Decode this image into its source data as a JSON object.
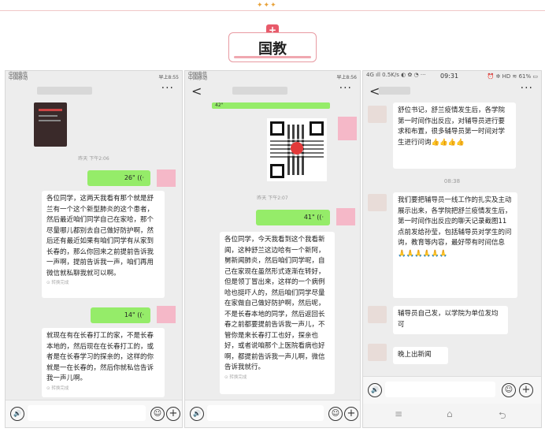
{
  "header": {
    "badge_label": "国教",
    "plus_symbol": "+",
    "dots": "✦✦✦"
  },
  "phone1": {
    "status_carrier": "中国电信\n中国移动",
    "status_time": "早上8:55",
    "more": "···",
    "timestamp": "昨天 下午2:06",
    "voice1": "26\" ((·",
    "voice2": "14\" ((·",
    "msg1": "各位同学，这两天我看有那个就是舒兰有一个这个新型肺炎的这个患者，然后最近咱们同学自己在家哈，那个尽量哪儿都别去自己做好防护啊，然后还有最近如果有咱们同学有从家到长春的，那么你回来之前提前告诉我一声啊，提前告诉我一声，咱们再用微信就私聊我就可以啊。",
    "msg1_note": "⊙ 转换完成",
    "msg2": "就现在有在长春打工的家，不是长春本地的，然后现在在长春打工的，或者是在长春学习的探亲的，这样的你就是一在长春的，然后你就私信告诉我一声儿啊。",
    "msg2_note": "⊙ 转换完成",
    "voice_icon": "🔊",
    "emoji": "☺",
    "plus": "+"
  },
  "phone2": {
    "status_carrier": "中国电信\n中国移动",
    "status_time": "早上8:56",
    "back": "<",
    "more": "···",
    "top_voice": "42\"",
    "timestamp": "昨天 下午2:07",
    "voice": "41\" ((·",
    "msg": "各位同学，今天我看到这个我看新闻，这种舒兰这边哈有一个新阿，舅新闻肺炎，然后咱们同学呢，自己在家现在虽然形式逐渐在转好，但是领丁冒出来，这样的一个病例哈也挺吓人的，然后咱们同学尽量在家做自己做好防护啊，然后呢，不是长春本地的同学，然后返回长春之前都要提前告诉我一声儿，不管你是来长春打工也好，探亲也好，或者说咱那个上医院看病也好啊，都提前告诉我一声儿啊，微信告诉我就行。",
    "msg_note": "⊙ 转换完成",
    "voice_icon": "🔊",
    "emoji": "☺",
    "plus": "+"
  },
  "phone3": {
    "status_left": "4G ıll 0.5K/s ◐ ✿ ◔ ···",
    "status_time": "09:31",
    "status_right": "⏰ ✲ HD ≋ 61% ▭",
    "back": "<",
    "more": "···",
    "msg1": "舒位书记，舒兰疫情发生后，各学院第一时间作出反应，对辅导员进行要求和布置，很多辅导员第一时间对学生进行问询👍👍👍👍",
    "timestamp": "08:38",
    "msg2": "我们要把辅导员一线工作的扎实及主动展示出来，各学院把舒兰疫情发生后，第一时间作出反应的聊天记录截图11点前发给孙莹，包括辅导员对学生的问询，教育等内容，最好带有时间信息🙏🙏🙏🙏🙏🙏",
    "msg3": "辅导员自己发，以学院为单位发均可",
    "msg4": "晚上出新闻",
    "voice_icon": "🔊",
    "emoji": "☺",
    "plus": "+",
    "nav_menu": "≡",
    "nav_home": "⌂",
    "nav_back": "⮌"
  }
}
